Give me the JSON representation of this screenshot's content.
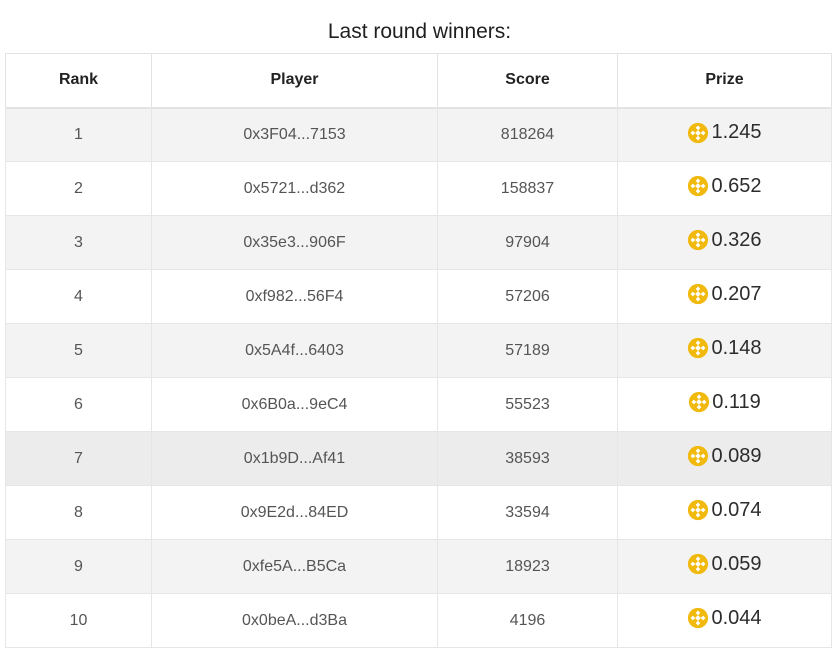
{
  "title": "Last round winners:",
  "columns": {
    "rank": "Rank",
    "player": "Player",
    "score": "Score",
    "prize": "Prize"
  },
  "rows": [
    {
      "rank": "1",
      "player": "0x3F04...7153",
      "score": "818264",
      "prize": "1.245"
    },
    {
      "rank": "2",
      "player": "0x5721...d362",
      "score": "158837",
      "prize": "0.652"
    },
    {
      "rank": "3",
      "player": "0x35e3...906F",
      "score": "97904",
      "prize": "0.326"
    },
    {
      "rank": "4",
      "player": "0xf982...56F4",
      "score": "57206",
      "prize": "0.207"
    },
    {
      "rank": "5",
      "player": "0x5A4f...6403",
      "score": "57189",
      "prize": "0.148"
    },
    {
      "rank": "6",
      "player": "0x6B0a...9eC4",
      "score": "55523",
      "prize": "0.119"
    },
    {
      "rank": "7",
      "player": "0x1b9D...Af41",
      "score": "38593",
      "prize": "0.089"
    },
    {
      "rank": "8",
      "player": "0x9E2d...84ED",
      "score": "33594",
      "prize": "0.074"
    },
    {
      "rank": "9",
      "player": "0xfe5A...B5Ca",
      "score": "18923",
      "prize": "0.059"
    },
    {
      "rank": "10",
      "player": "0x0beA...d3Ba",
      "score": "4196",
      "prize": "0.044"
    }
  ],
  "icons": {
    "prize_coin": "bnb-coin-icon"
  },
  "colors": {
    "coin": "#f0b90b",
    "row_stripe": "#f3f3f3",
    "border": "#e3e3e3"
  }
}
